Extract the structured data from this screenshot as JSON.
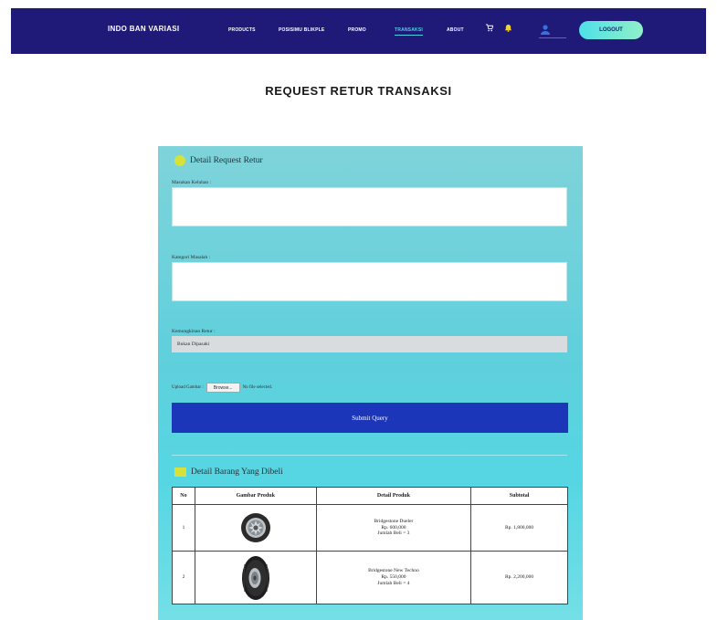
{
  "nav": {
    "brand": "INDO BAN VARIASI",
    "items": [
      {
        "label": "PRODUCTS"
      },
      {
        "label": "POSISIMU BLIKPLE"
      },
      {
        "label": "PROMO"
      },
      {
        "label": "TRANSAKSI"
      },
      {
        "label": "ABOUT"
      }
    ],
    "cart_icon": "cart-icon",
    "bell_icon": "bell-icon",
    "user_icon": "user-icon",
    "logout_label": "LOGOUT"
  },
  "page": {
    "title": "REQUEST RETUR TRANSAKSI"
  },
  "form": {
    "heading": "Detail Request Retur",
    "field1_label": "Masukan Keluhan :",
    "field1_value": "",
    "field2_label": "Kategori Masalah :",
    "field2_value": "",
    "select_label": "Kemungkinan Retur :",
    "select_value": "Bukan Dipasaki",
    "upload_label": "Upload Gambar :",
    "browse_label": "Browse...",
    "file_status": "No file selected.",
    "submit_label": "Submit Query"
  },
  "items": {
    "heading": "Detail Barang Yang Dibeli",
    "columns": [
      "No",
      "Gambar Produk",
      "Detail Produk",
      "Subtotal"
    ],
    "rows": [
      {
        "no": "1",
        "name": "Bridgestone Dueler",
        "price": "Rp. 600,000",
        "qty": "Jumlah Beli = 3",
        "subtotal": "Rp. 1,800,000",
        "image_icon": "wheel-icon"
      },
      {
        "no": "2",
        "name": "Bridgestone New Techno",
        "price": "Rp. 550,000",
        "qty": "Jumlah Beli = 4",
        "subtotal": "Rp. 2,200,000",
        "image_icon": "tire-icon"
      }
    ]
  },
  "colors": {
    "navbar": "#1f1a78",
    "accent": "#4fd1e8",
    "card": "#5fd0dc",
    "submit": "#1b36b8",
    "badge": "#d6e23a"
  }
}
